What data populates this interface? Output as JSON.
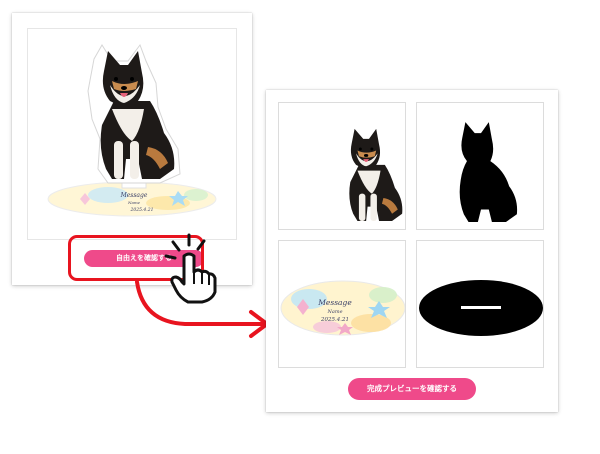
{
  "colors": {
    "accent_pink": "#ef4a8a",
    "highlight_red": "#e8141f",
    "silhouette": "#000000",
    "card_bg": "#ffffff",
    "border": "#dcdcdc"
  },
  "left_card": {
    "stand_plate_message": "Message",
    "stand_plate_name": "Name",
    "stand_plate_date": "2025.4.21",
    "confirm_button_label": "自由えを確認する"
  },
  "right_card": {
    "color_stand_message": "Message",
    "color_stand_name": "Name",
    "color_stand_date": "2025.4.21",
    "final_preview_button_label": "完成プレビューを確認する"
  },
  "icons": {
    "hand": "pointing-hand-cursor-icon",
    "arrow": "flow-arrow-icon"
  }
}
